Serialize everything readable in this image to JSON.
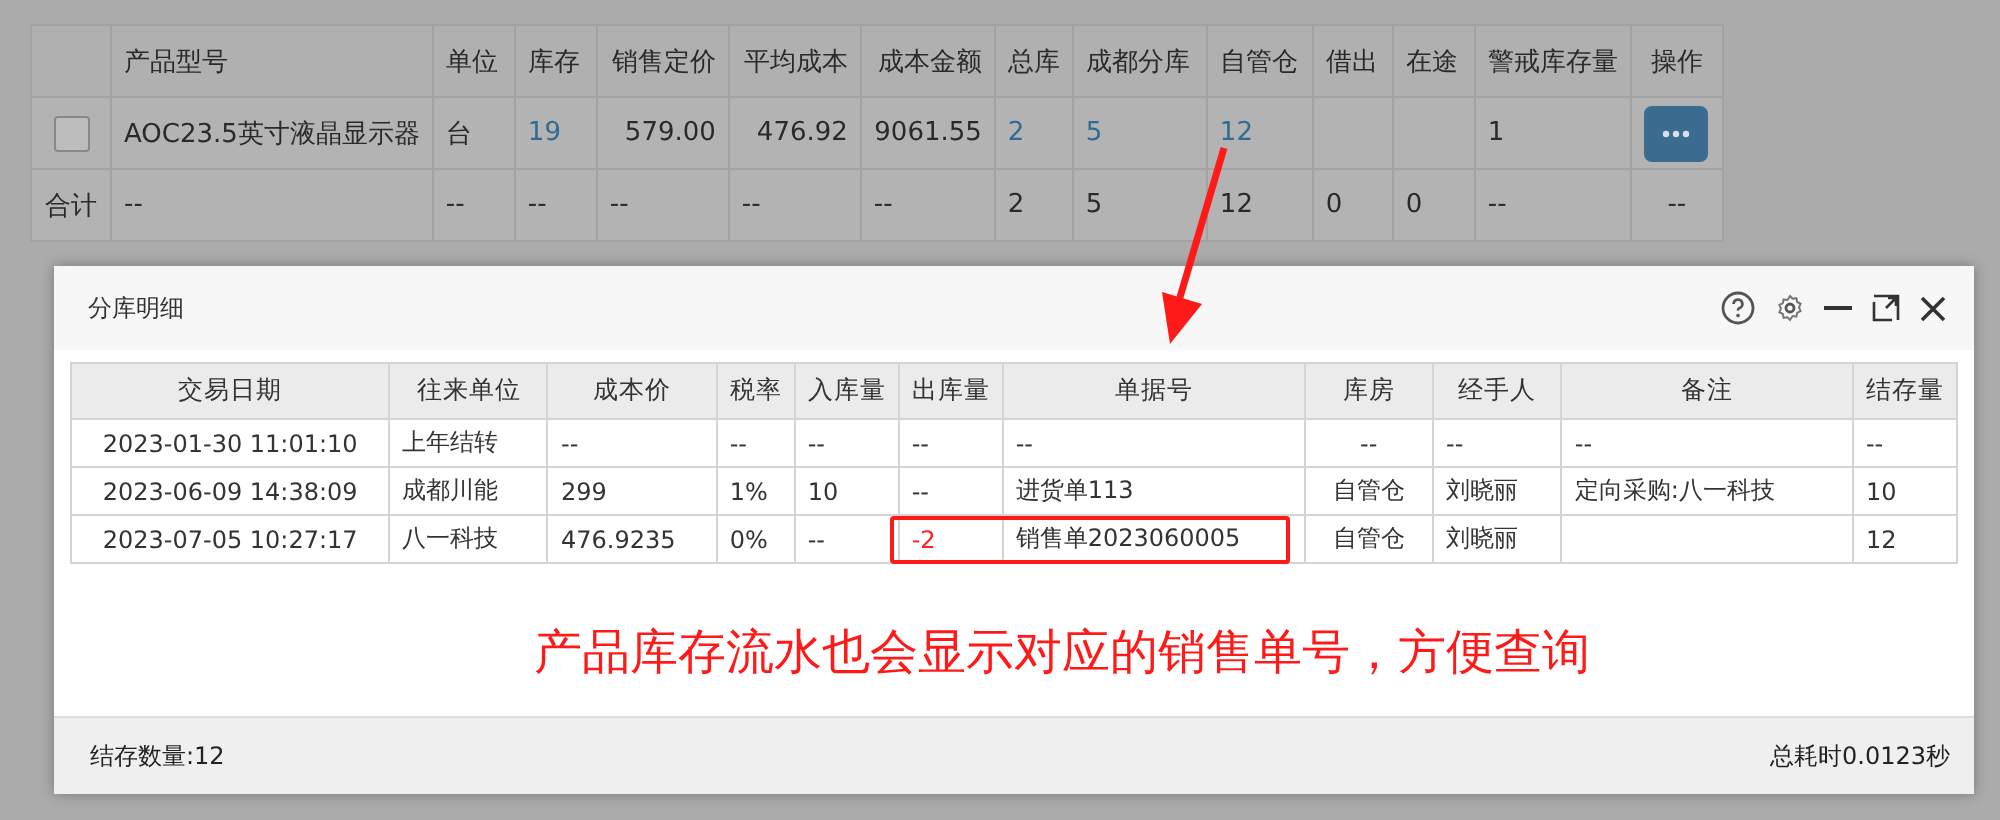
{
  "product_table": {
    "columns": [
      "",
      "产品型号",
      "单位",
      "库存",
      "销售定价",
      "平均成本",
      "成本金额",
      "总库",
      "成都分库",
      "自管仓",
      "借出",
      "在途",
      "警戒库存量",
      "操作"
    ],
    "rows": [
      {
        "cells": [
          {
            "kind": "checkbox",
            "checked": false
          },
          {
            "text": "AOC23.5英寸液晶显示器"
          },
          {
            "text": "台"
          },
          {
            "kind": "link",
            "text": "19"
          },
          {
            "text": "579.00"
          },
          {
            "text": "476.92"
          },
          {
            "text": "9061.55"
          },
          {
            "kind": "link",
            "text": "2"
          },
          {
            "kind": "link",
            "text": "5"
          },
          {
            "kind": "link",
            "text": "12"
          },
          {},
          {},
          {
            "text": "1"
          },
          {
            "kind": "action"
          }
        ]
      }
    ],
    "totals": [
      "合计",
      "--",
      "--",
      "--",
      "--",
      "--",
      "--",
      "2",
      "5",
      "12",
      "0",
      "0",
      "--",
      "--"
    ]
  },
  "dialog": {
    "title": "分库明细",
    "columns": [
      "交易日期",
      "往来单位",
      "成本价",
      "税率",
      "入库量",
      "出库量",
      "单据号",
      "库房",
      "经手人",
      "备注",
      "结存量"
    ],
    "rows": [
      {
        "highlighted": false,
        "cells": [
          {
            "text": "2023-01-30 11:01:10"
          },
          {
            "text": "上年结转"
          },
          {
            "text": "--"
          },
          {
            "text": "--"
          },
          {
            "text": "--"
          },
          {
            "text": "--"
          },
          {
            "text": "--"
          },
          {
            "text": "--"
          },
          {
            "text": "--"
          },
          {
            "text": "--"
          },
          {
            "text": "--"
          }
        ]
      },
      {
        "highlighted": false,
        "cells": [
          {
            "text": "2023-06-09 14:38:09"
          },
          {
            "text": "成都川能"
          },
          {
            "text": "299"
          },
          {
            "text": "1%"
          },
          {
            "text": "10"
          },
          {
            "text": "--"
          },
          {
            "text": "进货单113"
          },
          {
            "text": "自管仓"
          },
          {
            "text": "刘晓丽"
          },
          {
            "text": "定向采购:八一科技"
          },
          {
            "text": "10"
          }
        ]
      },
      {
        "highlighted": true,
        "cells": [
          {
            "text": "2023-07-05 10:27:17"
          },
          {
            "text": "八一科技"
          },
          {
            "text": "476.9235"
          },
          {
            "text": "0%"
          },
          {
            "text": "--"
          },
          {
            "negative": true,
            "text": "-2"
          },
          {
            "text": "销售单2023060005"
          },
          {
            "text": "自管仓"
          },
          {
            "text": "刘晓丽"
          },
          {},
          {
            "text": "12"
          }
        ]
      }
    ],
    "annotation": "产品库存流水也会显示对应的销售单号，方便查询",
    "footer_left": "结存数量:12",
    "footer_right": "总耗时0.0123秒"
  }
}
